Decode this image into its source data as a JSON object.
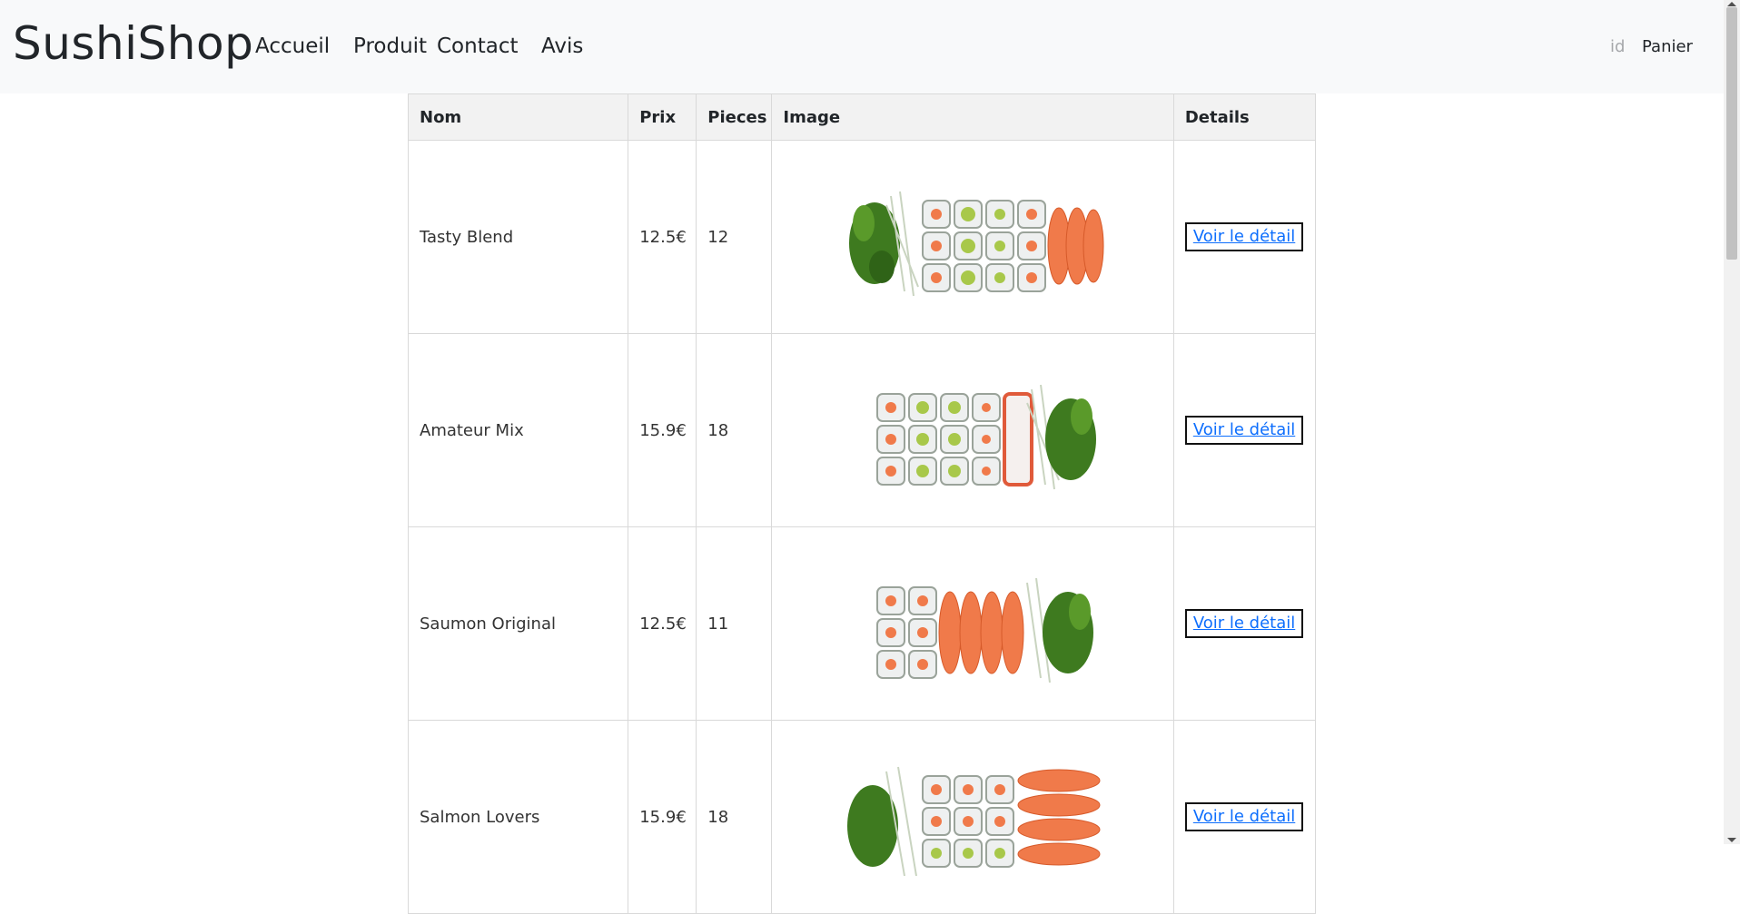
{
  "nav": {
    "brand": "SushiShop",
    "links": [
      "Accueil",
      "Produit",
      "Contact",
      "Avis"
    ],
    "id_label": "id",
    "cart_label": "Panier"
  },
  "table": {
    "headers": [
      "Nom",
      "Prix",
      "Pieces",
      "Image",
      "Details"
    ],
    "rows": [
      {
        "name": "Tasty Blend",
        "price": "12.5€",
        "pieces": "12",
        "image": "tasty-blend-platter",
        "details_label": "Voir le détail"
      },
      {
        "name": "Amateur Mix",
        "price": "15.9€",
        "pieces": "18",
        "image": "amateur-mix-platter",
        "details_label": "Voir le détail"
      },
      {
        "name": "Saumon Original",
        "price": "12.5€",
        "pieces": "11",
        "image": "saumon-original-platter",
        "details_label": "Voir le détail"
      },
      {
        "name": "Salmon Lovers",
        "price": "15.9€",
        "pieces": "18",
        "image": "salmon-lovers-platter",
        "details_label": "Voir le détail"
      }
    ]
  },
  "colors": {
    "navbar_bg": "#f8f9fa",
    "header_bg": "#f2f2f2",
    "link": "#0d6efd",
    "salmon": "#f07a4a",
    "rice": "#eef0f0",
    "avocado": "#a8c84a",
    "nori": "#3e4a3e",
    "greens": "#3e7a1f"
  }
}
